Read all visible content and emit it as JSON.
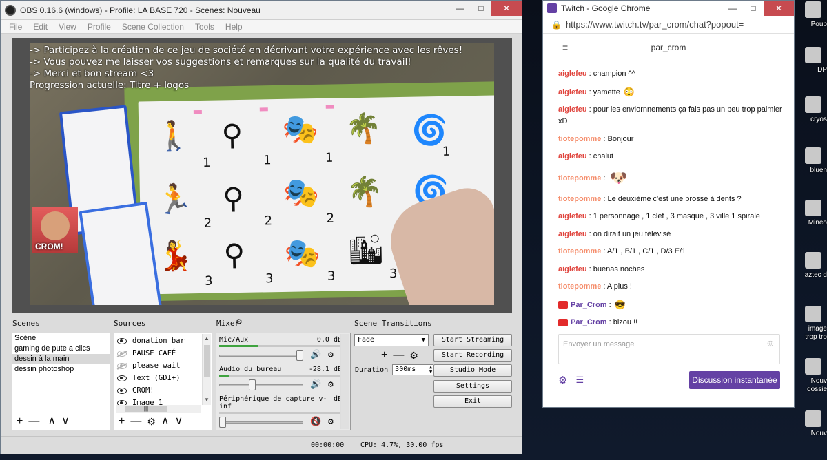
{
  "obs": {
    "title": "OBS 0.16.6 (windows) - Profile: LA BASE 720 - Scenes: Nouveau",
    "menu": [
      "File",
      "Edit",
      "View",
      "Profile",
      "Scene Collection",
      "Tools",
      "Help"
    ],
    "overlay_lines": [
      "-> Participez à la création de ce jeu de société en décrivant votre expérience avec les rêves!",
      "-> Vous pouvez me laisser vos suggestions et remarques sur la qualité du travail!",
      "-> Merci et bon stream <3",
      "Progression actuelle: Titre + logos"
    ],
    "webcam_label": "CROM!",
    "scenes_label": "Scenes",
    "scenes": [
      {
        "name": "Scène",
        "selected": false
      },
      {
        "name": "gaming de pute a clics",
        "selected": false
      },
      {
        "name": "dessin à la main",
        "selected": true
      },
      {
        "name": "dessin photoshop",
        "selected": false
      }
    ],
    "sources_label": "Sources",
    "sources": [
      {
        "name": "donation bar",
        "visible": true
      },
      {
        "name": "PAUSE CAFÉ",
        "visible": false
      },
      {
        "name": "please wait",
        "visible": false
      },
      {
        "name": "Text (GDI+)",
        "visible": true
      },
      {
        "name": "CROM!",
        "visible": true
      },
      {
        "name": "Image 1",
        "visible": true
      }
    ],
    "mixer_label": "Mixer",
    "mixer": [
      {
        "name": "Mic/Aux",
        "db": "0.0 dB",
        "level": 0.32,
        "volume": 1.0,
        "muted": false
      },
      {
        "name": "Audio du bureau",
        "db": "-28.1 dB",
        "level": 0.08,
        "volume": 0.38,
        "muted": false
      },
      {
        "name": "Périphérique de capture v-inf",
        "db": "dB",
        "level": 0.0,
        "volume": 0.0,
        "muted": true
      }
    ],
    "transitions_label": "Scene Transitions",
    "transition": "Fade",
    "duration_label": "Duration",
    "duration_value": "300ms",
    "buttons": {
      "start_streaming": "Start Streaming",
      "start_recording": "Start Recording",
      "studio_mode": "Studio Mode",
      "settings": "Settings",
      "exit": "Exit"
    },
    "status": {
      "time": "00:00:00",
      "cpu": "CPU: 4.7%, 30.00 fps"
    },
    "icons": {
      "add": "plus-icon",
      "remove": "minus-icon",
      "up": "arrow-up-icon",
      "down": "arrow-down-icon",
      "gear": "gear-icon"
    }
  },
  "chrome": {
    "title": "Twitch - Google Chrome",
    "url": "https://www.twitch.tv/par_crom/chat?popout=",
    "channel": "par_crom",
    "messages": [
      {
        "user": "aiglefeu",
        "text": "champion ^^",
        "color": "#e0453e",
        "emote": ""
      },
      {
        "user": "aiglefeu",
        "text": "yamette",
        "color": "#e0453e",
        "emote": "face"
      },
      {
        "user": "aiglefeu",
        "text": "pour les enviornnements ça fais pas un peu trop palmier xD",
        "color": "#e0453e",
        "emote": ""
      },
      {
        "user": "tiotepomme",
        "text": "Bonjour",
        "color": "#f58c6a",
        "emote": ""
      },
      {
        "user": "aiglefeu",
        "text": "chalut",
        "color": "#e0453e",
        "emote": ""
      },
      {
        "user": "tiotepomme",
        "text": "",
        "color": "#f58c6a",
        "emote": "dog"
      },
      {
        "user": "tiotepomme",
        "text": "Le deuxième c'est une brosse à dents ?",
        "color": "#f58c6a",
        "emote": ""
      },
      {
        "user": "aiglefeu",
        "text": "1 personnage , 1 clef , 3 masque , 3 ville 1 spirale",
        "color": "#e0453e",
        "emote": ""
      },
      {
        "user": "aiglefeu",
        "text": "on dirait un jeu télévisé",
        "color": "#e0453e",
        "emote": ""
      },
      {
        "user": "tiotepomme",
        "text": "A/1 , B/1 , C/1 , D/3 E/1",
        "color": "#f58c6a",
        "emote": ""
      },
      {
        "user": "aiglefeu",
        "text": "buenas noches",
        "color": "#e0453e",
        "emote": ""
      },
      {
        "user": "tiotepomme",
        "text": "A plus !",
        "color": "#f58c6a",
        "emote": ""
      },
      {
        "user": "Par_Crom",
        "text": "",
        "color": "#6441a4",
        "emote": "sunglasses",
        "broadcaster": true
      },
      {
        "user": "Par_Crom",
        "text": "bizou !!",
        "color": "#6441a4",
        "emote": "",
        "broadcaster": true
      }
    ],
    "input_placeholder": "Envoyer un message",
    "send_label": "Discussion instantanée",
    "accent": "#6441a4"
  },
  "desktop_icons": [
    {
      "label": "Poub"
    },
    {
      "label": "DP"
    },
    {
      "label": "cryos"
    },
    {
      "label": "bluen"
    },
    {
      "label": "Mineo"
    },
    {
      "label": "aztec d"
    },
    {
      "label": "image\ntrop tro"
    },
    {
      "label": "Nouv\ndossie"
    },
    {
      "label": "Nouv"
    }
  ]
}
